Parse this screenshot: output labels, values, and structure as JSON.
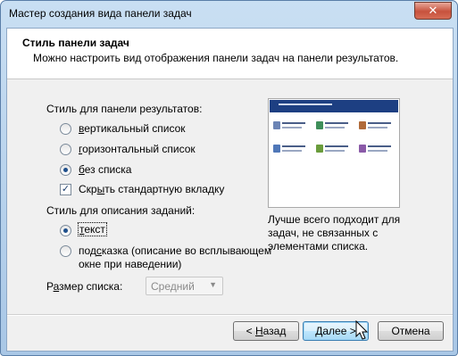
{
  "window": {
    "title": "Мастер создания вида панели задач",
    "close_glyph": "✕"
  },
  "header": {
    "title": "Стиль панели задач",
    "description": "Можно настроить вид отображения панели задач на панели результатов."
  },
  "results_style": {
    "label": "Стиль для панели результатов:",
    "options": [
      {
        "accel": "в",
        "rest": "ертикальный список",
        "selected": false
      },
      {
        "accel": "г",
        "rest": "оризонтальный список",
        "selected": false
      },
      {
        "accel": "б",
        "rest": "ез списка",
        "selected": true
      }
    ],
    "hide_tab": {
      "pre": "Скр",
      "accel": "ы",
      "post": "ть стандартную вкладку",
      "checked": true
    }
  },
  "task_desc_style": {
    "label": "Стиль для описания заданий:",
    "options": [
      {
        "accel": "т",
        "rest": "екст",
        "selected": true
      },
      {
        "pre": "под",
        "accel": "с",
        "rest": "казка (описание во всплывающем",
        "line2": "окне при наведении)",
        "selected": false
      }
    ]
  },
  "list_size": {
    "pre": "Р",
    "accel": "а",
    "post": "змер списка:",
    "value": "Средний"
  },
  "preview": {
    "caption_lines": [
      "Лучше всего подходит для",
      "задач, не связанных с",
      "элементами списка."
    ]
  },
  "buttons": {
    "back": {
      "arrow": "< ",
      "accel": "Н",
      "rest": "азад"
    },
    "next": {
      "accel": "Д",
      "rest": "алее",
      "arrow": " >"
    },
    "cancel": "Отмена"
  }
}
